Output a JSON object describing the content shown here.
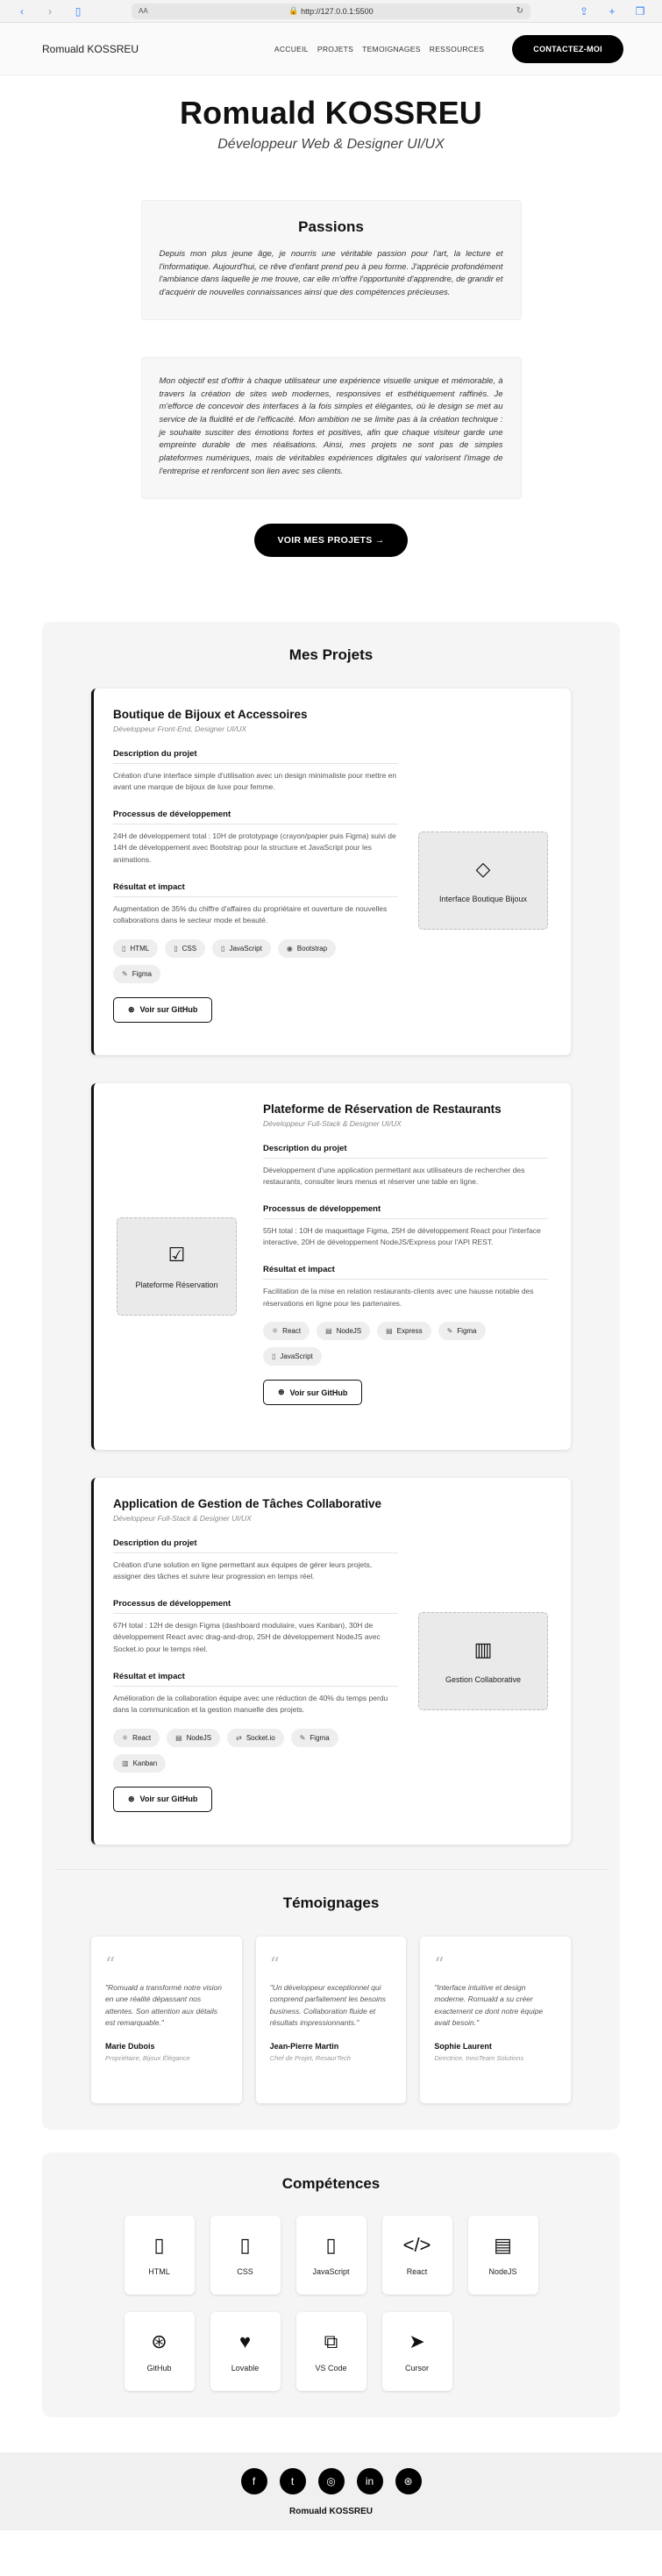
{
  "browser": {
    "url": "http://127.0.0.1:5500",
    "aa": "AA"
  },
  "header": {
    "brand": "Romuald KOSSREU",
    "nav": [
      "ACCUEIL",
      "PROJETS",
      "TEMOIGNAGES",
      "RESSOURCES"
    ],
    "contact": "CONTACTEZ-MOI"
  },
  "hero": {
    "title": "Romuald KOSSREU",
    "subtitle": "Développeur Web & Designer UI/UX",
    "passions_title": "Passions",
    "passions_text": "Depuis mon plus jeune âge, je nourris une véritable passion pour l'art, la lecture et l'informatique. Aujourd'hui, ce rêve d'enfant prend peu à peu forme. J'apprécie profondément l'ambiance dans laquelle je me trouve, car elle m'offre l'opportunité d'apprendre, de grandir et d'acquérir de nouvelles connaissances ainsi que des compétences précieuses.",
    "objective_text": "Mon objectif est d'offrir à chaque utilisateur une expérience visuelle unique et mémorable, à travers la création de sites web modernes, responsives et esthétiquement raffinés. Je m'efforce de concevoir des interfaces à la fois simples et élégantes, où le design se met au service de la fluidité et de l'efficacité. Mon ambition ne se limite pas à la création technique : je souhaite susciter des émotions fortes et positives, afin que chaque visiteur garde une empreinte durable de mes réalisations. Ainsi, mes projets ne sont pas de simples plateformes numériques, mais de véritables expériences digitales qui valorisent l'image de l'entreprise et renforcent son lien avec ses clients.",
    "cta": "VOIR MES PROJETS →"
  },
  "projects": {
    "title": "Mes Projets",
    "labels": {
      "description": "Description du projet",
      "process": "Processus de développement",
      "result": "Résultat et impact",
      "github": "Voir sur GitHub"
    },
    "items": [
      {
        "title": "Boutique de Bijoux et Accessoires",
        "role": "Développeur Front-End, Designer UI/UX",
        "description": "Création d'une interface simple d'utilisation avec un design minimaliste pour mettre en avant une marque de bijoux de luxe pour femme.",
        "process": "24H de développement total : 10H de prototypage (crayon/papier puis Figma) suivi de 14H de développement avec Bootstrap pour la structure et JavaScript pour les animations.",
        "result": "Augmentation de 35% du chiffre d'affaires du propriétaire et ouverture de nouvelles collaborations dans le secteur mode et beauté.",
        "tags": [
          "HTML",
          "CSS",
          "JavaScript",
          "Bootstrap",
          "Figma"
        ],
        "thumb_label": "Interface Boutique Bijoux",
        "thumb_icon": "gem-icon"
      },
      {
        "title": "Plateforme de Réservation de Restaurants",
        "role": "Développeur Full-Stack & Designer UI/UX",
        "description": "Développement d'une application permettant aux utilisateurs de rechercher des restaurants, consulter leurs menus et réserver une table en ligne.",
        "process": "55H total : 10H de maquettage Figma, 25H de développement React pour l'interface interactive, 20H de développement NodeJS/Express pour l'API REST.",
        "result": "Facilitation de la mise en relation restaurants-clients avec une hausse notable des réservations en ligne pour les partenaires.",
        "tags": [
          "React",
          "NodeJS",
          "Express",
          "Figma",
          "JavaScript"
        ],
        "thumb_label": "Plateforme Réservation",
        "thumb_icon": "calendar-check-icon"
      },
      {
        "title": "Application de Gestion de Tâches Collaborative",
        "role": "Développeur Full-Stack & Designer UI/UX",
        "description": "Création d'une solution en ligne permettant aux équipes de gérer leurs projets, assigner des tâches et suivre leur progression en temps réel.",
        "process": "67H total : 12H de design Figma (dashboard modulaire, vues Kanban), 30H de développement React avec drag-and-drop, 25H de développement NodeJS avec Socket.io pour le temps réel.",
        "result": "Amélioration de la collaboration équipe avec une réduction de 40% du temps perdu dans la communication et la gestion manuelle des projets.",
        "tags": [
          "React",
          "NodeJS",
          "Socket.io",
          "Figma",
          "Kanban"
        ],
        "thumb_label": "Gestion Collaborative",
        "thumb_icon": "trello-icon"
      }
    ]
  },
  "testimonials": {
    "title": "Témoignages",
    "items": [
      {
        "text": "\"Romuald a transformé notre vision en une réalité dépassant nos attentes. Son attention aux détails est remarquable.\"",
        "name": "Marie Dubois",
        "position": "Propriétaire, Bijoux Élégance"
      },
      {
        "text": "\"Un développeur exceptionnel qui comprend parfaitement les besoins business. Collaboration fluide et résultats impressionnants.\"",
        "name": "Jean-Pierre Martin",
        "position": "Chef de Projet, ResaurTech"
      },
      {
        "text": "\"Interface intuitive et design moderne. Romuald a su créer exactement ce dont notre équipe avait besoin.\"",
        "name": "Sophie Laurent",
        "position": "Directrice, InnoTeam Solutions"
      }
    ]
  },
  "skills": {
    "title": "Compétences",
    "items": [
      {
        "label": "HTML",
        "icon": "html-file-icon"
      },
      {
        "label": "CSS",
        "icon": "css-file-icon"
      },
      {
        "label": "JavaScript",
        "icon": "js-file-icon"
      },
      {
        "label": "React",
        "icon": "code-icon"
      },
      {
        "label": "NodeJS",
        "icon": "database-icon"
      },
      {
        "label": "GitHub",
        "icon": "github-icon"
      },
      {
        "label": "Lovable",
        "icon": "heart-icon"
      },
      {
        "label": "VS Code",
        "icon": "vscode-icon"
      },
      {
        "label": "Cursor",
        "icon": "cursor-icon"
      }
    ]
  },
  "footer": {
    "socials": [
      "facebook-icon",
      "twitter-icon",
      "instagram-icon",
      "linkedin-icon",
      "github-icon"
    ],
    "copyright": "Romuald KOSSREU"
  }
}
